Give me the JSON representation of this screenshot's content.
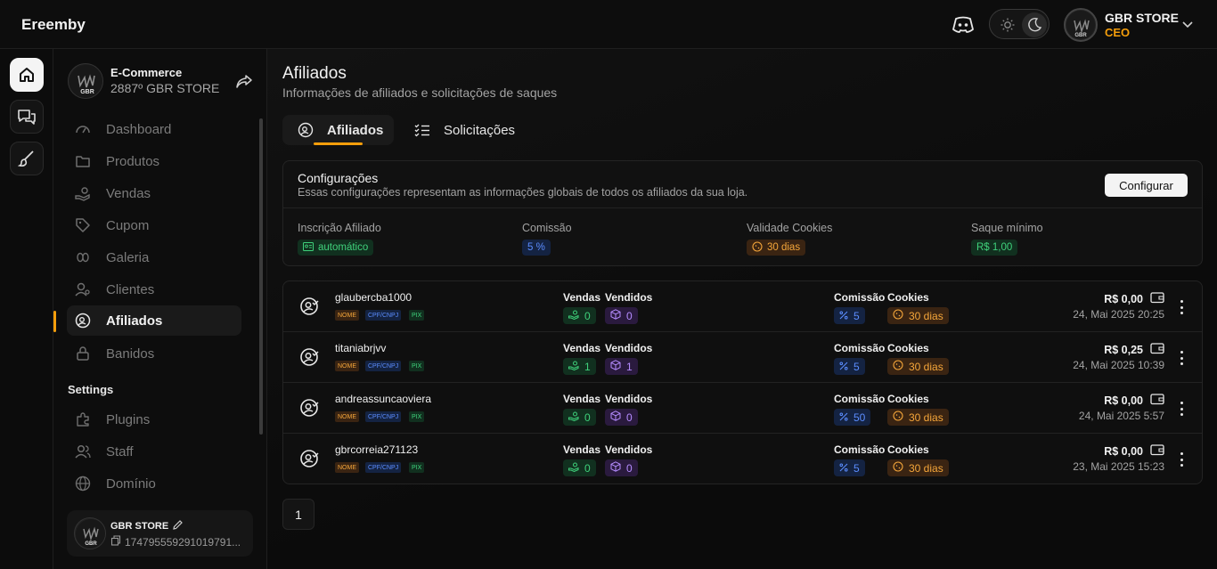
{
  "app": {
    "brand": "Ereemby"
  },
  "header": {
    "user_name": "GBR STORE",
    "user_role": "CEO"
  },
  "sidebar": {
    "store_category": "E-Commerce",
    "store_rank": "2887º GBR STORE",
    "nav": [
      {
        "label": "Dashboard",
        "icon": "gauge-icon"
      },
      {
        "label": "Produtos",
        "icon": "folder-icon"
      },
      {
        "label": "Vendas",
        "icon": "hand-coins-icon"
      },
      {
        "label": "Cupom",
        "icon": "tag-icon"
      },
      {
        "label": "Galeria",
        "icon": "gallery-icon"
      },
      {
        "label": "Clientes",
        "icon": "users-icon"
      },
      {
        "label": "Afiliados",
        "icon": "affiliate-icon"
      },
      {
        "label": "Banidos",
        "icon": "lock-icon"
      }
    ],
    "settings_title": "Settings",
    "settings_nav": [
      {
        "label": "Plugins",
        "icon": "puzzle-icon"
      },
      {
        "label": "Staff",
        "icon": "staff-icon"
      },
      {
        "label": "Domínio",
        "icon": "globe-icon"
      }
    ],
    "footer_user": {
      "name": "GBR STORE",
      "id": "174795559291019791..."
    }
  },
  "main": {
    "title": "Afiliados",
    "subtitle": "Informações de afiliados e solicitações de saques",
    "tabs": [
      {
        "label": "Afiliados"
      },
      {
        "label": "Solicitações"
      }
    ],
    "config": {
      "title": "Configurações",
      "subtitle": "Essas configurações representam as informações globais de todos os afiliados da sua loja.",
      "button": "Configurar",
      "stats": [
        {
          "label": "Inscrição Afiliado",
          "value": "automático",
          "color": "green"
        },
        {
          "label": "Comissão",
          "value": "5 %",
          "color": "blue"
        },
        {
          "label": "Validade Cookies",
          "value": "30 dias",
          "color": "orange"
        },
        {
          "label": "Saque mínimo",
          "value": "R$ 1,00",
          "color": "green"
        }
      ]
    },
    "columns": {
      "vendas": "Vendas",
      "vendidos": "Vendidos",
      "comissao": "Comissão",
      "cookies": "Cookies"
    },
    "tags": {
      "nome": "NOME",
      "cpf": "CPF/CNPJ",
      "pix": "PIX"
    },
    "affiliates": [
      {
        "username": "glaubercba1000",
        "vendas": "0",
        "vendidos": "0",
        "comissao": "5",
        "cookies": "30 dias",
        "saldo": "R$ 0,00",
        "date": "24, Mai 2025 20:25"
      },
      {
        "username": "titaniabrjvv",
        "vendas": "1",
        "vendidos": "1",
        "comissao": "5",
        "cookies": "30 dias",
        "saldo": "R$ 0,25",
        "date": "24, Mai 2025 10:39"
      },
      {
        "username": "andreassuncaoviera",
        "vendas": "0",
        "vendidos": "0",
        "comissao": "50",
        "cookies": "30 dias",
        "saldo": "R$ 0,00",
        "date": "24, Mai 2025 5:57"
      },
      {
        "username": "gbrcorreia271123",
        "vendas": "0",
        "vendidos": "0",
        "comissao": "5",
        "cookies": "30 dias",
        "saldo": "R$ 0,00",
        "date": "23, Mai 2025 15:23"
      }
    ],
    "pagination": {
      "current": "1"
    }
  },
  "colors": {
    "accent": "#f59e0b",
    "green": "#3fd17b",
    "blue": "#5b8dff",
    "purple": "#b58cff"
  }
}
